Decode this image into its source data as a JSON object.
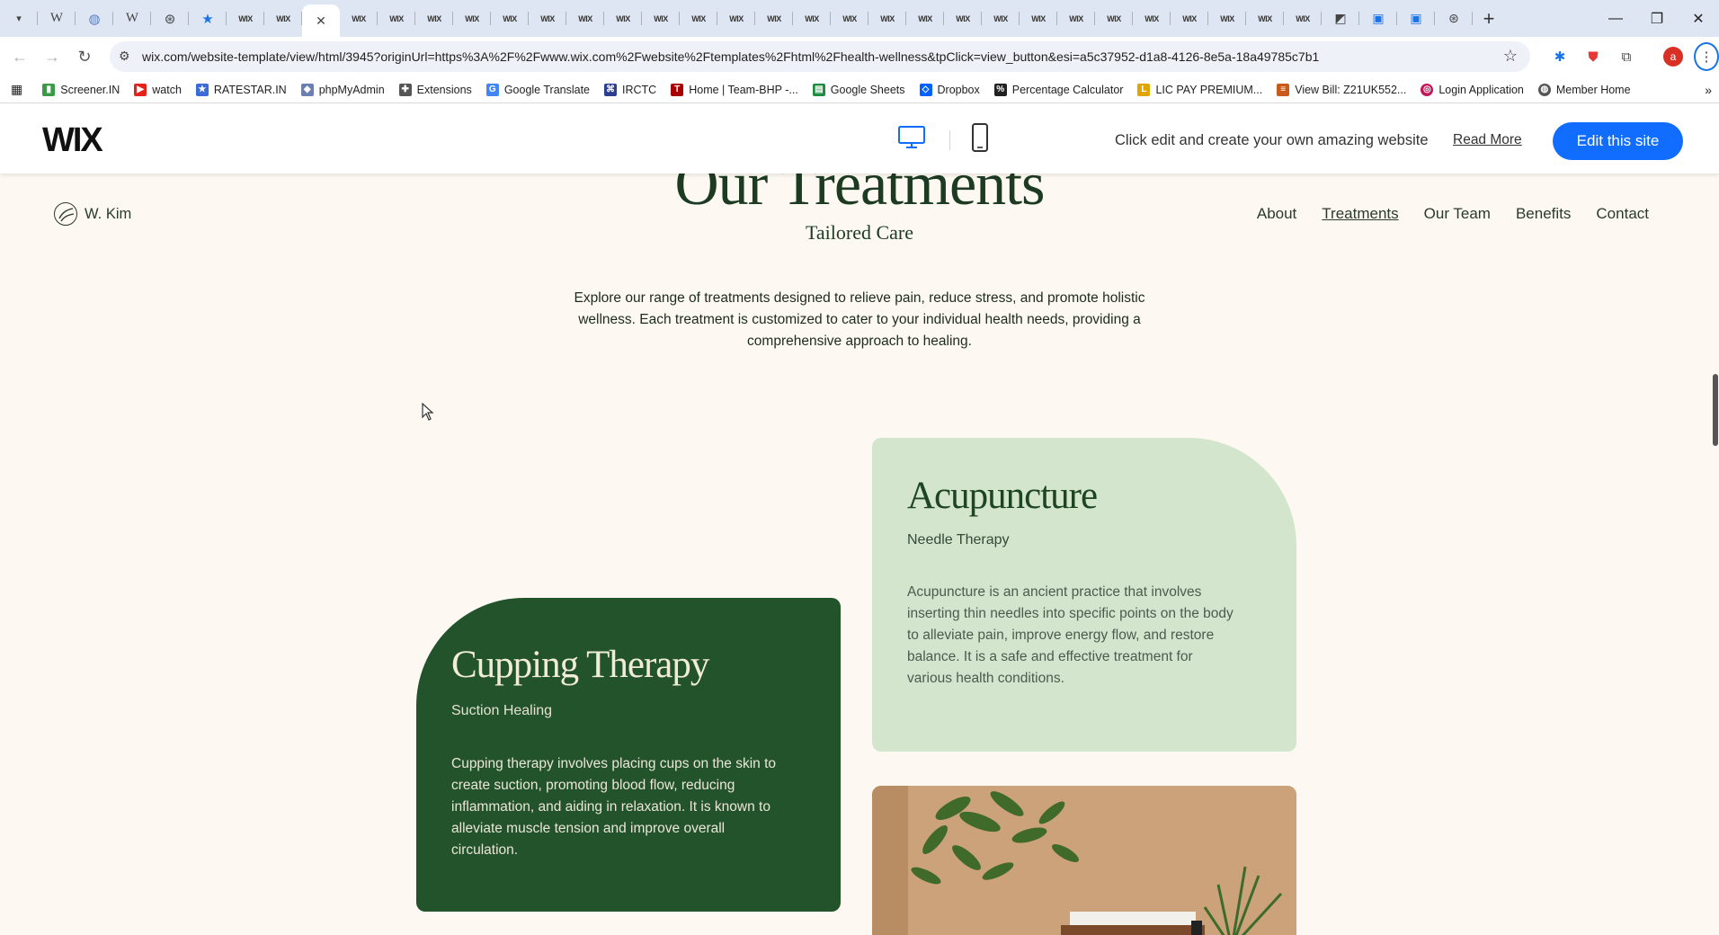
{
  "browser": {
    "tab_count_label": "",
    "url": "wix.com/website-template/view/html/3945?originUrl=https%3A%2F%2Fwww.wix.com%2Fwebsite%2Ftemplates%2Fhtml%2Fhealth-wellness&tpClick=view_button&esi=a5c37952-d1a8-4126-8e5a-18a49785c7b1",
    "tab_label_wix": "WIX",
    "bookmarks": [
      {
        "label": "Screener.IN",
        "icon": "bar-chart-icon",
        "color": "#3a9b46"
      },
      {
        "label": "watch",
        "icon": "youtube-icon",
        "color": "#e62117"
      },
      {
        "label": "RATESTAR.IN",
        "icon": "star-icon",
        "color": "#3a6bd6"
      },
      {
        "label": "phpMyAdmin",
        "icon": "php-icon",
        "color": "#6b7fb3"
      },
      {
        "label": "Extensions",
        "icon": "puzzle-icon",
        "color": "#555555"
      },
      {
        "label": "Google Translate",
        "icon": "translate-icon",
        "color": "#4285f4"
      },
      {
        "label": "IRCTC",
        "icon": "train-icon",
        "color": "#2c3e8f"
      },
      {
        "label": "Home | Team-BHP -...",
        "icon": "team-bhp-icon",
        "color": "#a80000"
      },
      {
        "label": "Google Sheets",
        "icon": "sheets-icon",
        "color": "#1e8e3e"
      },
      {
        "label": "Dropbox",
        "icon": "dropbox-icon",
        "color": "#0061fe"
      },
      {
        "label": "Percentage Calculator",
        "icon": "calculator-icon",
        "color": "#222222"
      },
      {
        "label": "LIC PAY PREMIUM...",
        "icon": "lic-icon",
        "color": "#e3a400"
      },
      {
        "label": "View Bill: Z21UK552...",
        "icon": "bill-icon",
        "color": "#c85a1a"
      },
      {
        "label": "Login Application",
        "icon": "login-icon",
        "color": "#c2185b"
      },
      {
        "label": "Member Home",
        "icon": "globe-icon",
        "color": "#555555"
      }
    ]
  },
  "wix_bar": {
    "logo": "WIX",
    "promo_text": "Click edit and create your own amazing website",
    "read_more": "Read More",
    "edit_button": "Edit this site",
    "accent": "#116dff"
  },
  "site": {
    "brand": "W. Kim",
    "nav": [
      "About",
      "Treatments",
      "Our Team",
      "Benefits",
      "Contact"
    ],
    "active_nav": "Treatments",
    "section_title": "Our Treatments",
    "section_subtitle": "Tailored Care",
    "intro": "Explore our range of treatments designed to relieve pain, reduce stress, and promote holistic wellness. Each treatment is customized to cater to your individual health needs, providing a comprehensive approach to healing.",
    "treatments": [
      {
        "title": "Acupuncture",
        "subtitle": "Needle Therapy",
        "description": "Acupuncture is an ancient practice that involves inserting thin needles into specific points on the body to alleviate pain, improve energy flow, and restore balance. It is a safe and effective treatment for various health conditions.",
        "color": "#d3e6cd"
      },
      {
        "title": "Cupping Therapy",
        "subtitle": "Suction Healing",
        "description": "Cupping therapy involves placing cups on the skin to create suction, promoting blood flow, reducing inflammation, and aiding in relaxation. It is known to alleviate muscle tension and improve overall circulation.",
        "color": "#23532a"
      }
    ]
  }
}
